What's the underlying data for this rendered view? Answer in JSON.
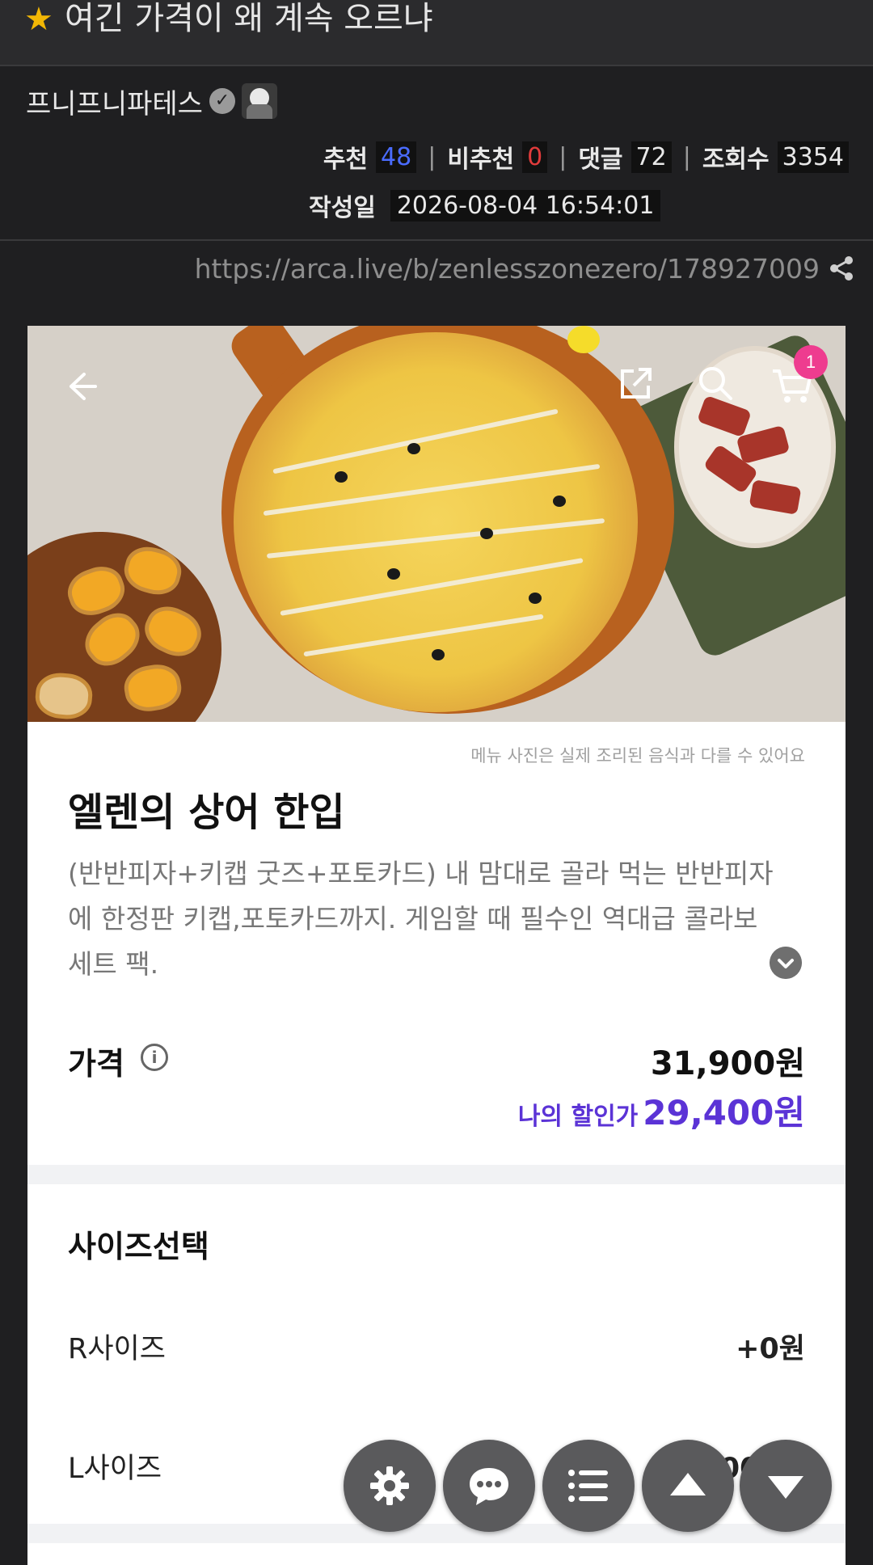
{
  "post": {
    "title": "여긴 가격이 왜 계속 오르냐",
    "author": "프니프니파테스",
    "stats": {
      "recommend_label": "추천",
      "recommend_value": "48",
      "not_recommend_label": "비추천",
      "not_recommend_value": "0",
      "comments_label": "댓글",
      "comments_value": "72",
      "views_label": "조회수",
      "views_value": "3354"
    },
    "date_label": "작성일",
    "date_value": "2026-08-04 16:54:01",
    "url": "https://arca.live/b/zenlesszonezero/178927009"
  },
  "product": {
    "cart_count": "1",
    "disclaimer": "메뉴 사진은 실제 조리된 음식과 다를 수 있어요",
    "name": "엘렌의 상어 한입",
    "description": "(반반피자+키캡 굿즈+포토카드) 내 맘대로 골라 먹는 반반피자에 한정판 키캡,포토카드까지. 게임할 때 필수인 역대급 콜라보 세트 팩.",
    "price_label": "가격",
    "price_value": "31,900원",
    "discount_label": "나의 할인가",
    "discount_value": "29,400원",
    "size_title": "사이즈선택",
    "sizes": [
      {
        "name": "R사이즈",
        "price": "+0원"
      },
      {
        "name": "L사이즈",
        "price": "+4,000원"
      }
    ]
  },
  "icons": [
    "star-icon",
    "verified-icon",
    "share-icon",
    "back-icon",
    "external-link-icon",
    "search-icon",
    "cart-icon",
    "chevron-down-icon",
    "info-icon",
    "gear-icon",
    "chat-icon",
    "list-icon",
    "arrow-up-icon",
    "arrow-down-icon"
  ],
  "colors": {
    "page_bg": "#1f1f21",
    "recommend": "#4a6cff",
    "not_recommend": "#e03b3b",
    "discount": "#5b33d6",
    "cart_badge": "#ee3c8f",
    "fab": "#5a5a5c"
  }
}
